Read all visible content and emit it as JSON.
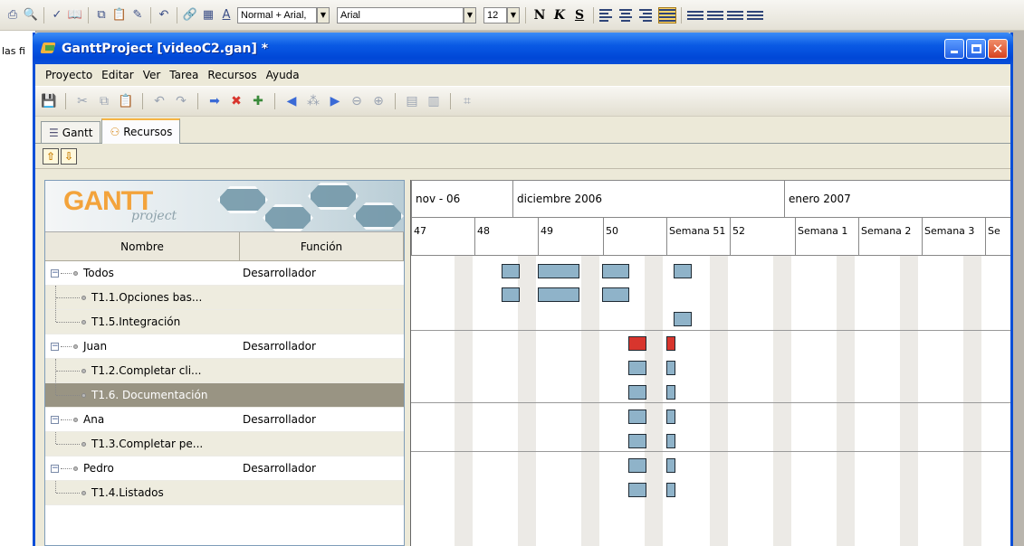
{
  "word_toolbar": {
    "style_value": "Normal + Arial,",
    "font_value": "Arial",
    "size_value": "12",
    "bold_label": "N",
    "italic_label": "K",
    "underline_label": "S"
  },
  "doc_left": {
    "text": "las fi"
  },
  "window": {
    "title": "GanttProject [videoC2.gan] *",
    "menu": [
      "Proyecto",
      "Editar",
      "Ver",
      "Tarea",
      "Recursos",
      "Ayuda"
    ],
    "tabs": [
      {
        "label": "Gantt",
        "icon": "gantt-icon"
      },
      {
        "label": "Recursos",
        "icon": "resources-icon",
        "active": true
      }
    ]
  },
  "logo": {
    "text": "GANTT",
    "sub": "project"
  },
  "table": {
    "headers": [
      "Nombre",
      "Función"
    ],
    "rows": [
      {
        "name": "Todos",
        "role": "Desarrollador",
        "level": 0
      },
      {
        "name": "T1.1.Opciones bas...",
        "role": "",
        "level": 1
      },
      {
        "name": "T1.5.Integración",
        "role": "",
        "level": 1
      },
      {
        "name": "Juan",
        "role": "Desarrollador",
        "level": 0
      },
      {
        "name": "T1.2.Completar cli...",
        "role": "",
        "level": 1
      },
      {
        "name": "T1.6. Documentación",
        "role": "",
        "level": 1,
        "selected": true
      },
      {
        "name": "Ana",
        "role": "Desarrollador",
        "level": 0
      },
      {
        "name": "T1.3.Completar pe...",
        "role": "",
        "level": 1
      },
      {
        "name": "Pedro",
        "role": "Desarrollador",
        "level": 0
      },
      {
        "name": "T1.4.Listados",
        "role": "",
        "level": 1
      }
    ]
  },
  "timeline": {
    "months": [
      "nov - 06",
      "diciembre 2006",
      "enero 2007"
    ],
    "weeks": [
      "47",
      "48",
      "49",
      "50",
      "Semana 51",
      "52",
      "Semana 1",
      "Semana 2",
      "Semana 3",
      "Se"
    ]
  },
  "colors": {
    "bar": "#8fb3c9",
    "overload": "#d8352d",
    "titlebar": "#0a5ae4"
  }
}
